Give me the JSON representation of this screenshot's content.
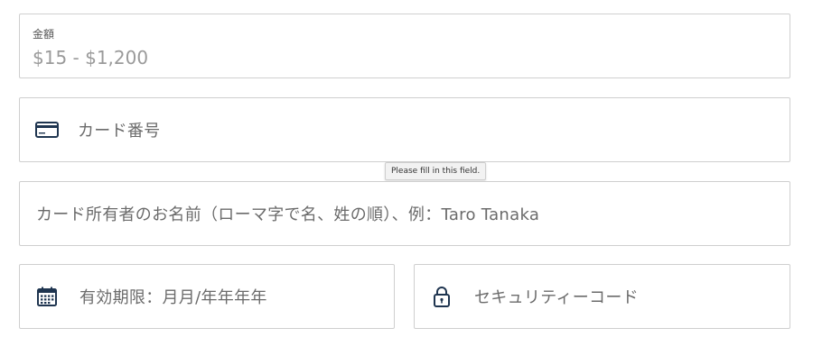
{
  "amount": {
    "label": "金額",
    "value": "$15 - $1,200"
  },
  "card_number": {
    "placeholder": "カード番号",
    "icon": "credit-card-icon"
  },
  "tooltip": {
    "text": "Please fill in this field."
  },
  "cardholder": {
    "placeholder": "カード所有者のお名前（ローマ字で名、姓の順）、例：Taro Tanaka"
  },
  "expiry": {
    "placeholder": "有効期限：月月/年年年年",
    "icon": "calendar-icon"
  },
  "cvc": {
    "placeholder": "セキュリティーコード",
    "icon": "lock-icon"
  },
  "colors": {
    "border": "#cfcfcf",
    "icon": "#1f3550",
    "placeholder": "#6b6b6b"
  }
}
